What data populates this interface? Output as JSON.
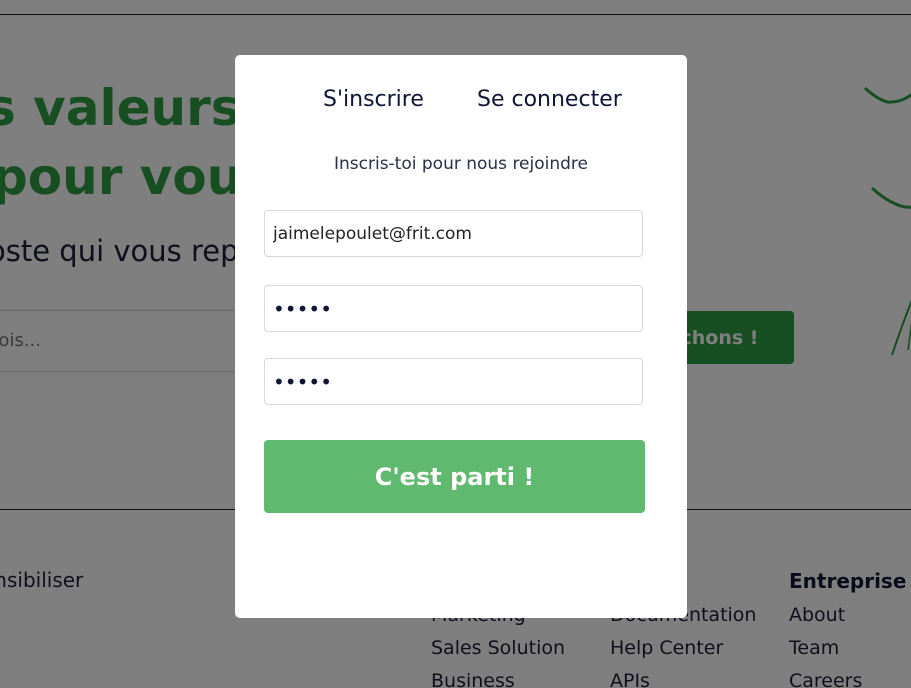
{
  "background": {
    "hero": {
      "title_line1": "s valeurs c",
      "title_line2": " pour vou",
      "subtitle": "oste qui vous rep"
    },
    "search": {
      "placeholder": "plois...",
      "button_label": "chons !"
    },
    "footer": {
      "left_text": "ensibiliser",
      "columns": [
        {
          "heading": "",
          "items": [
            "Marketing",
            "Sales Solution",
            "Business"
          ]
        },
        {
          "heading": ":",
          "items": [
            "Documentation",
            "Help Center",
            "APIs"
          ]
        },
        {
          "heading": "Entreprise",
          "items": [
            "About",
            "Team",
            "Careers"
          ]
        }
      ]
    }
  },
  "modal": {
    "tabs": {
      "signup": "S'inscrire",
      "signin": "Se connecter"
    },
    "subtitle": "Inscris-toi pour nous rejoindre",
    "email_value": "jaimelepoulet@frit.com",
    "password_value": "•••••",
    "password_confirm_value": "•••••",
    "submit_label": "C'est parti !"
  },
  "colors": {
    "brand_green": "#2f9e44",
    "submit_green": "#5fb96f",
    "text_dark": "#0f1635",
    "overlay": "rgba(0,0,0,0.5)"
  }
}
